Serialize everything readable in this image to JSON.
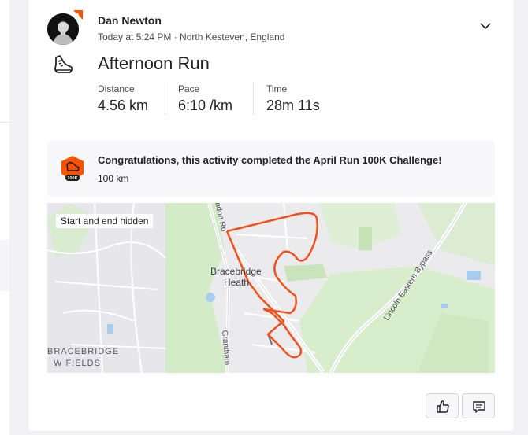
{
  "athlete": {
    "name": "Dan Newton",
    "meta": "Today at 5:24 PM · North Kesteven, England"
  },
  "activity": {
    "title": "Afternoon Run",
    "sport_icon": "running-shoe-icon",
    "stats": [
      {
        "label": "Distance",
        "value": "4.56 km"
      },
      {
        "label": "Pace",
        "value": "6:10 /km"
      },
      {
        "label": "Time",
        "value": "28m 11s"
      }
    ]
  },
  "challenge": {
    "title": "Congratulations, this activity completed the April Run 100K Challenge!",
    "subtitle": "100 km",
    "badge_text": "100K"
  },
  "map": {
    "privacy_tag": "Start and end hidden",
    "labels": {
      "town_line1": "Bracebridge",
      "town_line2": "Heath",
      "area_line1": "BRACEBRIDGE",
      "area_line2": "W FIELDS",
      "road_bypass": "Lincoln Eastern Bypass",
      "road_grantham": "Grantham",
      "road_london": "ndon Ro"
    },
    "route_color": "#f0521b"
  },
  "actions": {
    "kudos_icon": "thumbs-up-icon",
    "comment_icon": "comment-icon"
  },
  "colors": {
    "accent": "#fc5200",
    "text": "#242428"
  }
}
